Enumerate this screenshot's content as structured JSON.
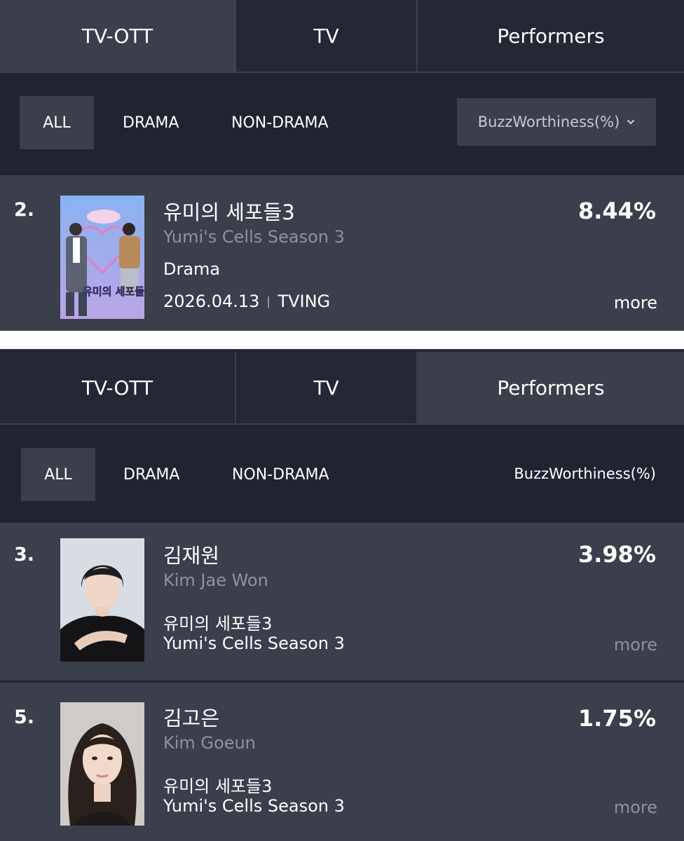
{
  "tabs": {
    "tv_ott": "TV-OTT",
    "tv": "TV",
    "performers": "Performers"
  },
  "filters": {
    "all": "ALL",
    "drama": "DRAMA",
    "non_drama": "NON-DRAMA"
  },
  "sort": {
    "label": "BuzzWorthiness(%)"
  },
  "program": {
    "rank": "2.",
    "title_ko": "유미의 세포들3",
    "title_en": "Yumi's Cells Season 3",
    "genre": "Drama",
    "date": "2026.04.13",
    "channel": "TVING",
    "percent": "8.44%",
    "more": "more",
    "poster_text": "유미의 세포들"
  },
  "performers": [
    {
      "rank": "3.",
      "name_ko": "김재원",
      "name_en": "Kim Jae Won",
      "show_ko": "유미의 세포들3",
      "show_en": "Yumi's Cells Season 3",
      "percent": "3.98%",
      "more": "more"
    },
    {
      "rank": "5.",
      "name_ko": "김고은",
      "name_en": "Kim Goeun",
      "show_ko": "유미의 세포들3",
      "show_en": "Yumi's Cells Season 3",
      "percent": "1.75%",
      "more": "more"
    }
  ],
  "icons": {
    "sort_dropdown": "chevron-down-icon"
  }
}
